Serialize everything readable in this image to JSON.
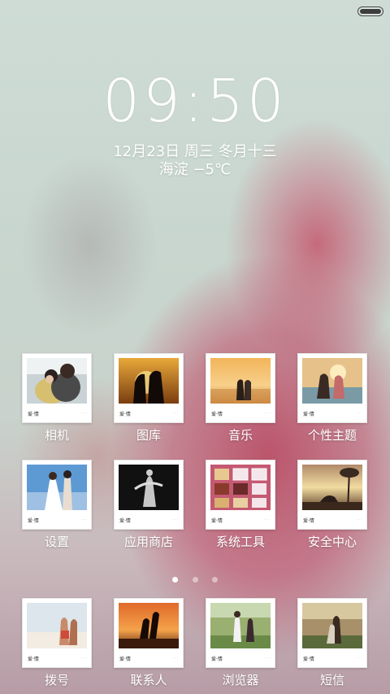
{
  "lockscreen": {
    "time": "09:50",
    "date": "12月23日 周三 冬月十三",
    "weather": "海淀 −5℃"
  },
  "thumbnail_caption": "爱·情",
  "apps_row1": [
    {
      "label": "相机",
      "icon": "camera-icon"
    },
    {
      "label": "图库",
      "icon": "gallery-icon"
    },
    {
      "label": "音乐",
      "icon": "music-icon"
    },
    {
      "label": "个性主题",
      "icon": "theme-icon"
    }
  ],
  "apps_row2": [
    {
      "label": "设置",
      "icon": "settings-icon"
    },
    {
      "label": "应用商店",
      "icon": "app-store-icon"
    },
    {
      "label": "系统工具",
      "icon": "system-tools-icon"
    },
    {
      "label": "安全中心",
      "icon": "security-icon"
    }
  ],
  "dock": [
    {
      "label": "拨号",
      "icon": "phone-icon"
    },
    {
      "label": "联系人",
      "icon": "contacts-icon"
    },
    {
      "label": "浏览器",
      "icon": "browser-icon"
    },
    {
      "label": "短信",
      "icon": "messages-icon"
    }
  ],
  "page_indicator": {
    "count": 3,
    "active": 1
  },
  "colors": {
    "text": "#ffffff",
    "accent_wallpaper": "#b9405c"
  }
}
